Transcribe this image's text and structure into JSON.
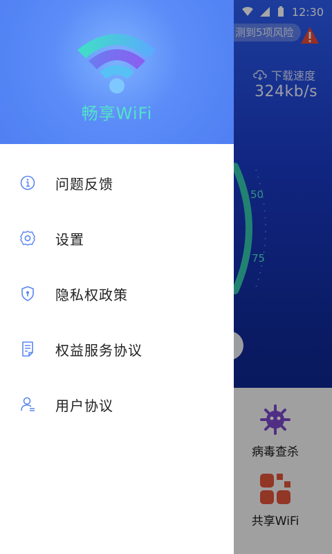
{
  "status_bar": {
    "time": "12:30"
  },
  "background": {
    "risk_text": "测到5项风险",
    "download_label": "下载速度",
    "download_value": "324kb/s",
    "gauge_ticks": [
      "50",
      "75"
    ],
    "tools": [
      {
        "label": "病毒查杀",
        "icon": "virus-icon"
      },
      {
        "label": "共享WiFi",
        "icon": "share-wifi-icon"
      }
    ]
  },
  "drawer": {
    "app_name": "畅享WiFi",
    "menu": [
      {
        "label": "问题反馈",
        "icon": "info-icon"
      },
      {
        "label": "设置",
        "icon": "gear-icon"
      },
      {
        "label": "隐私权政策",
        "icon": "shield-icon"
      },
      {
        "label": "权益服务协议",
        "icon": "document-icon"
      },
      {
        "label": "用户协议",
        "icon": "user-icon"
      }
    ]
  },
  "colors": {
    "accent": "#4f7ff2",
    "teal": "#52e3c8",
    "icon_blue": "#5a86f0"
  }
}
